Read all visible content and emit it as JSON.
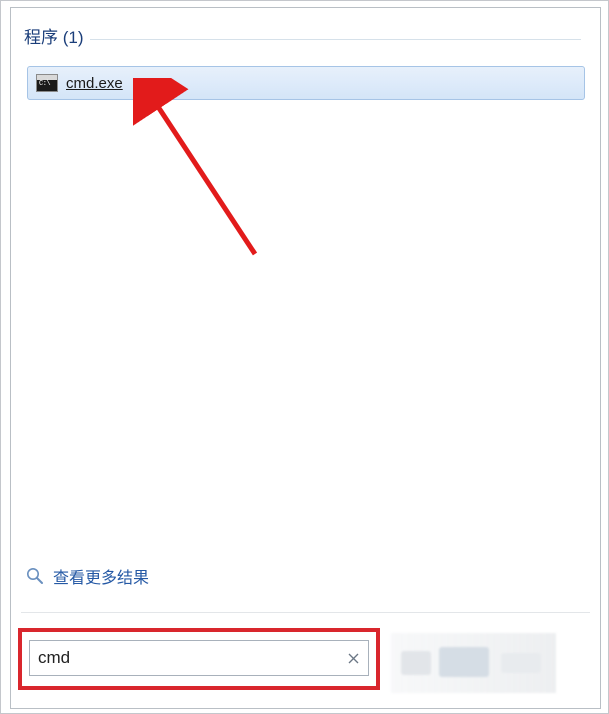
{
  "section": {
    "label": "程序 (1)"
  },
  "results": [
    {
      "icon": "cmd-icon",
      "icon_badge": "C:\\",
      "label": "cmd.exe"
    }
  ],
  "see_more": {
    "label": "查看更多结果"
  },
  "search": {
    "value": "cmd",
    "placeholder": ""
  },
  "colors": {
    "accent": "#2559a5",
    "highlight_border": "#d9262d",
    "arrow": "#e21b1b",
    "result_bg_top": "#e7f0fb",
    "result_bg_bottom": "#d4e5f8"
  }
}
